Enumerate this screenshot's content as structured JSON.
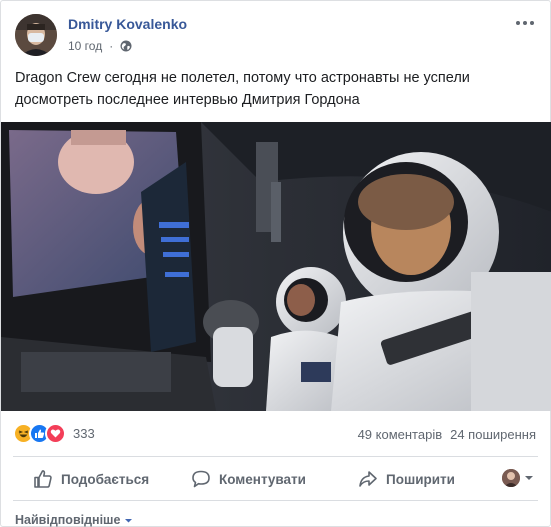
{
  "post": {
    "author": "Dmitry Kovalenko",
    "time": "10 год",
    "privacy_icon": "globe-icon",
    "text": "Dragon Crew сегодня не полетел, потому что астронавты не успели досмотреть последнее интервью Дмитрия Гордона",
    "menu_icon": "more-options-icon"
  },
  "reactions": {
    "icons": [
      "haha-icon",
      "like-icon",
      "love-icon"
    ],
    "count": "333",
    "comments": "49 коментарів",
    "shares": "24 поширення"
  },
  "actions": {
    "like": "Подобається",
    "comment": "Коментувати",
    "share": "Поширити"
  },
  "comments": {
    "sort_label": "Найвідповідніше"
  },
  "colors": {
    "author_link": "#385898",
    "secondary_text": "#606770",
    "like_blue": "#1877f2",
    "love_red": "#f33e58",
    "haha_yellow": "#f7b125"
  }
}
